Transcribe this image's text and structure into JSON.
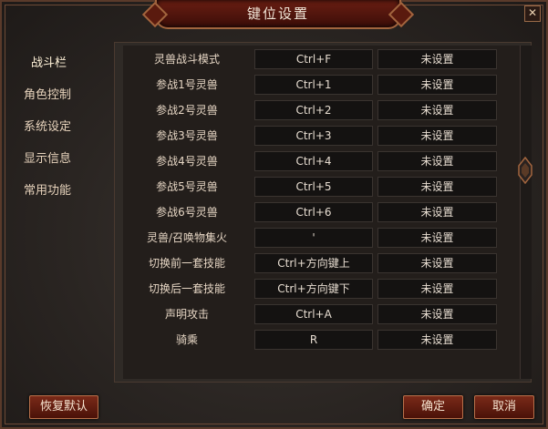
{
  "window": {
    "title": "键位设置",
    "close_glyph": "✕"
  },
  "sidebar": {
    "items": [
      {
        "label": "战斗栏",
        "active": true
      },
      {
        "label": "角色控制"
      },
      {
        "label": "系统设定"
      },
      {
        "label": "显示信息"
      },
      {
        "label": "常用功能"
      }
    ]
  },
  "rows": [
    {
      "label": "灵兽战斗模式",
      "key1": "Ctrl+F",
      "key2": "未设置"
    },
    {
      "label": "参战1号灵兽",
      "key1": "Ctrl+1",
      "key2": "未设置"
    },
    {
      "label": "参战2号灵兽",
      "key1": "Ctrl+2",
      "key2": "未设置"
    },
    {
      "label": "参战3号灵兽",
      "key1": "Ctrl+3",
      "key2": "未设置"
    },
    {
      "label": "参战4号灵兽",
      "key1": "Ctrl+4",
      "key2": "未设置"
    },
    {
      "label": "参战5号灵兽",
      "key1": "Ctrl+5",
      "key2": "未设置"
    },
    {
      "label": "参战6号灵兽",
      "key1": "Ctrl+6",
      "key2": "未设置"
    },
    {
      "label": "灵兽/召唤物集火",
      "key1": "'",
      "key2": "未设置"
    },
    {
      "label": "切换前一套技能",
      "key1": "Ctrl+方向键上",
      "key2": "未设置"
    },
    {
      "label": "切换后一套技能",
      "key1": "Ctrl+方向键下",
      "key2": "未设置"
    },
    {
      "label": "声明攻击",
      "key1": "Ctrl+A",
      "key2": "未设置"
    },
    {
      "label": "骑乘",
      "key1": "R",
      "key2": "未设置"
    }
  ],
  "footer": {
    "reset_label": "恢复默认",
    "ok_label": "确定",
    "cancel_label": "取消"
  }
}
